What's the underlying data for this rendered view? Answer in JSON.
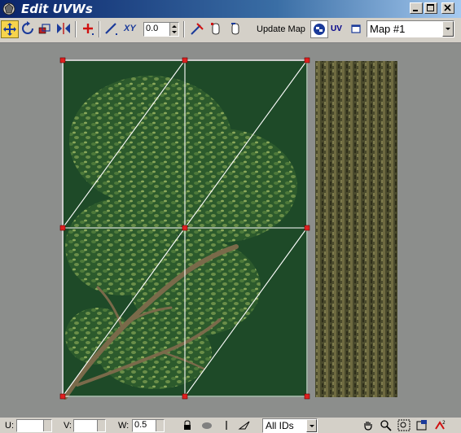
{
  "window": {
    "title": "Edit UVWs"
  },
  "toolbar": {
    "tools": [
      "move-icon",
      "rotate-icon",
      "scale-icon",
      "mirror-icon",
      "weld-icon",
      "freeform-icon",
      "xy-icon",
      "break-icon",
      "detach-icon",
      "attach-icon"
    ],
    "xy_label": "XY",
    "spinner_value": "0.0",
    "update_map_label": "Update Map",
    "uv_label": "UV",
    "map_select_value": "Map #1"
  },
  "bottombar": {
    "u_label": "U:",
    "u_value": "",
    "v_label": "V:",
    "v_value": "",
    "w_label": "W:",
    "w_value": "0.5",
    "ids_value": "All IDs",
    "nav_tools": [
      "pan-icon",
      "zoom-icon",
      "zoom-region-icon",
      "zoom-extents-icon",
      "lock-icon"
    ]
  },
  "colors": {
    "title_start": "#0a246a",
    "viewport_bg": "#8c8e8c",
    "leaf_bg": "#1f4a2a",
    "mesh_line": "#ffffff",
    "vertex": "#e02020",
    "bark": "#5a5a38"
  }
}
